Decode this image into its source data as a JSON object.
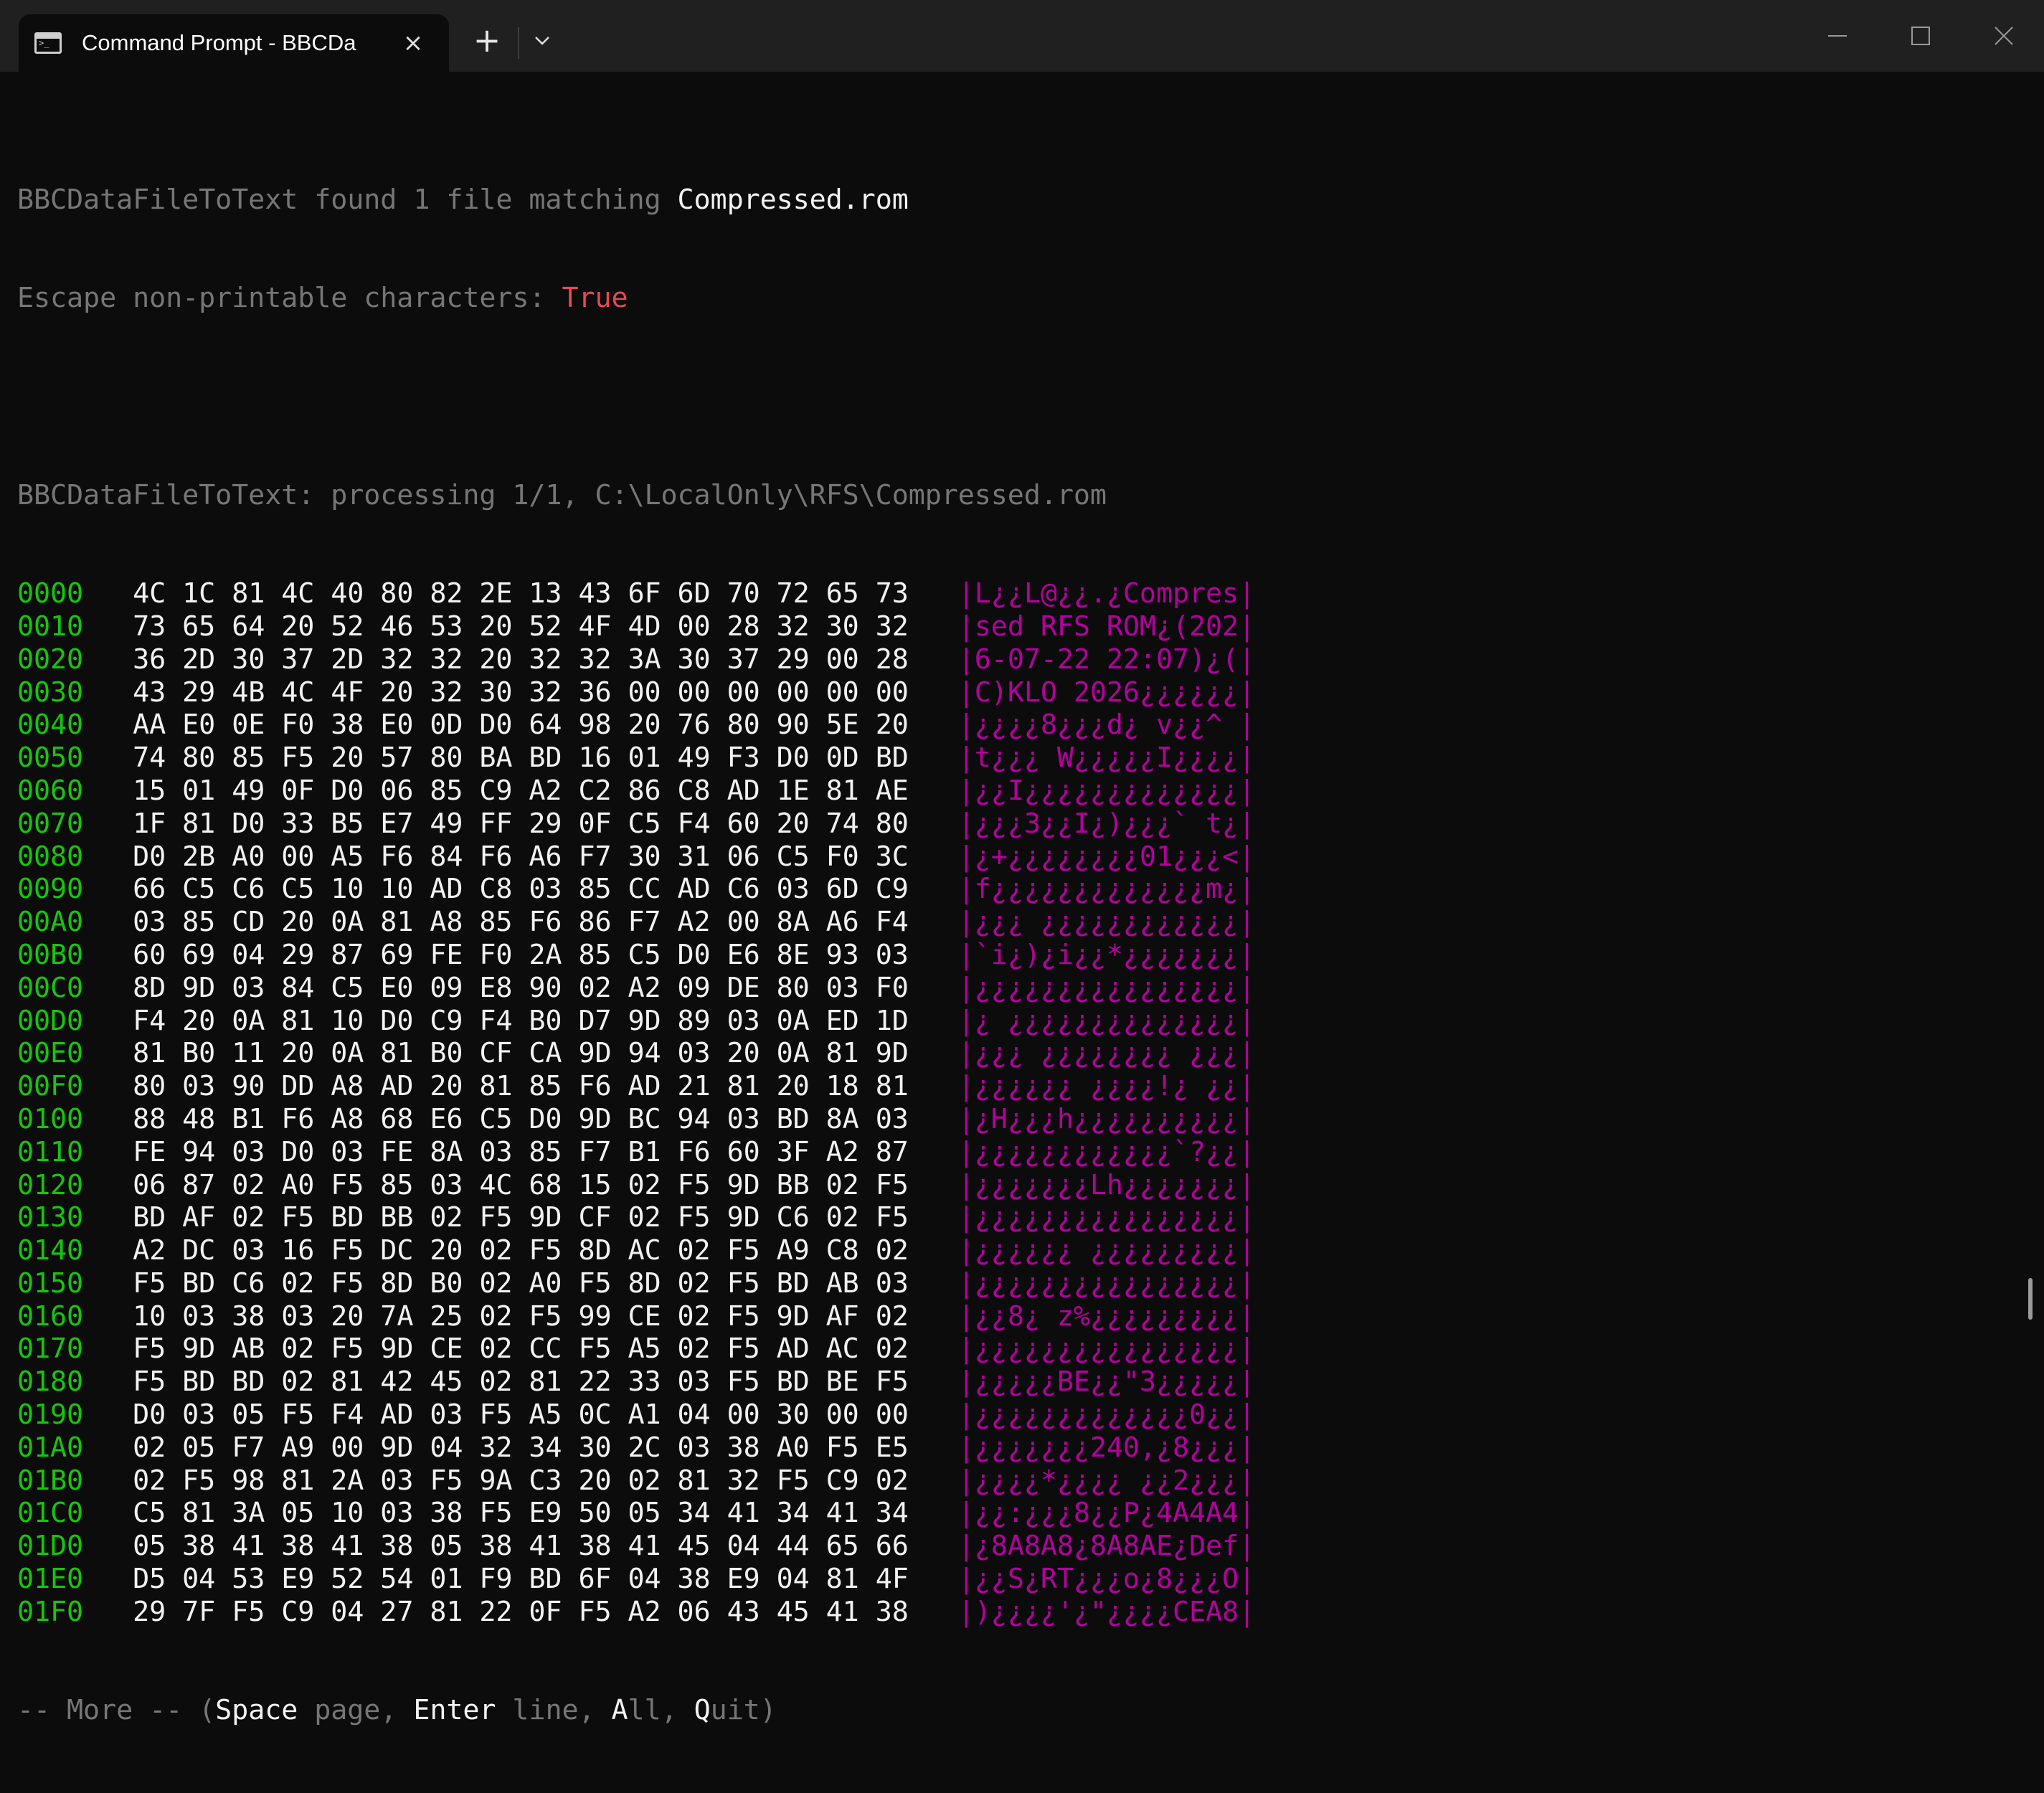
{
  "window": {
    "tab_title": "Command Prompt - BBCDa",
    "new_tab_label": "+",
    "close_tab_label": "×"
  },
  "terminal": {
    "line1": {
      "prefix": "BBCDataFileToText found 1 file matching ",
      "filename": "Compressed.rom"
    },
    "line2": {
      "prefix": "Escape non-printable characters: ",
      "value": "True"
    },
    "line4": "BBCDataFileToText: processing 1/1, C:\\LocalOnly\\RFS\\Compressed.rom",
    "dump": [
      {
        "addr": "0000",
        "hex": "4C 1C 81 4C 40 80 82 2E 13 43 6F 6D 70 72 65 73",
        "ascii": "|L¿¿L@¿¿.¿Compres|"
      },
      {
        "addr": "0010",
        "hex": "73 65 64 20 52 46 53 20 52 4F 4D 00 28 32 30 32",
        "ascii": "|sed RFS ROM¿(202|"
      },
      {
        "addr": "0020",
        "hex": "36 2D 30 37 2D 32 32 20 32 32 3A 30 37 29 00 28",
        "ascii": "|6-07-22 22:07)¿(|"
      },
      {
        "addr": "0030",
        "hex": "43 29 4B 4C 4F 20 32 30 32 36 00 00 00 00 00 00",
        "ascii": "|C)KLO 2026¿¿¿¿¿¿|"
      },
      {
        "addr": "0040",
        "hex": "AA E0 0E F0 38 E0 0D D0 64 98 20 76 80 90 5E 20",
        "ascii": "|¿¿¿¿8¿¿¿d¿ v¿¿^ |"
      },
      {
        "addr": "0050",
        "hex": "74 80 85 F5 20 57 80 BA BD 16 01 49 F3 D0 0D BD",
        "ascii": "|t¿¿¿ W¿¿¿¿¿I¿¿¿¿|"
      },
      {
        "addr": "0060",
        "hex": "15 01 49 0F D0 06 85 C9 A2 C2 86 C8 AD 1E 81 AE",
        "ascii": "|¿¿I¿¿¿¿¿¿¿¿¿¿¿¿¿|"
      },
      {
        "addr": "0070",
        "hex": "1F 81 D0 33 B5 E7 49 FF 29 0F C5 F4 60 20 74 80",
        "ascii": "|¿¿¿3¿¿I¿)¿¿¿` t¿|"
      },
      {
        "addr": "0080",
        "hex": "D0 2B A0 00 A5 F6 84 F6 A6 F7 30 31 06 C5 F0 3C",
        "ascii": "|¿+¿¿¿¿¿¿¿¿01¿¿¿<|"
      },
      {
        "addr": "0090",
        "hex": "66 C5 C6 C5 10 10 AD C8 03 85 CC AD C6 03 6D C9",
        "ascii": "|f¿¿¿¿¿¿¿¿¿¿¿¿¿m¿|"
      },
      {
        "addr": "00A0",
        "hex": "03 85 CD 20 0A 81 A8 85 F6 86 F7 A2 00 8A A6 F4",
        "ascii": "|¿¿¿ ¿¿¿¿¿¿¿¿¿¿¿¿|"
      },
      {
        "addr": "00B0",
        "hex": "60 69 04 29 87 69 FE F0 2A 85 C5 D0 E6 8E 93 03",
        "ascii": "|`i¿)¿i¿¿*¿¿¿¿¿¿¿|"
      },
      {
        "addr": "00C0",
        "hex": "8D 9D 03 84 C5 E0 09 E8 90 02 A2 09 DE 80 03 F0",
        "ascii": "|¿¿¿¿¿¿¿¿¿¿¿¿¿¿¿¿|"
      },
      {
        "addr": "00D0",
        "hex": "F4 20 0A 81 10 D0 C9 F4 B0 D7 9D 89 03 0A ED 1D",
        "ascii": "|¿ ¿¿¿¿¿¿¿¿¿¿¿¿¿¿|"
      },
      {
        "addr": "00E0",
        "hex": "81 B0 11 20 0A 81 B0 CF CA 9D 94 03 20 0A 81 9D",
        "ascii": "|¿¿¿ ¿¿¿¿¿¿¿¿ ¿¿¿|"
      },
      {
        "addr": "00F0",
        "hex": "80 03 90 DD A8 AD 20 81 85 F6 AD 21 81 20 18 81",
        "ascii": "|¿¿¿¿¿¿ ¿¿¿¿!¿ ¿¿|"
      },
      {
        "addr": "0100",
        "hex": "88 48 B1 F6 A8 68 E6 C5 D0 9D BC 94 03 BD 8A 03",
        "ascii": "|¿H¿¿¿h¿¿¿¿¿¿¿¿¿¿|"
      },
      {
        "addr": "0110",
        "hex": "FE 94 03 D0 03 FE 8A 03 85 F7 B1 F6 60 3F A2 87",
        "ascii": "|¿¿¿¿¿¿¿¿¿¿¿¿`?¿¿|"
      },
      {
        "addr": "0120",
        "hex": "06 87 02 A0 F5 85 03 4C 68 15 02 F5 9D BB 02 F5",
        "ascii": "|¿¿¿¿¿¿¿Lh¿¿¿¿¿¿¿|"
      },
      {
        "addr": "0130",
        "hex": "BD AF 02 F5 BD BB 02 F5 9D CF 02 F5 9D C6 02 F5",
        "ascii": "|¿¿¿¿¿¿¿¿¿¿¿¿¿¿¿¿|"
      },
      {
        "addr": "0140",
        "hex": "A2 DC 03 16 F5 DC 20 02 F5 8D AC 02 F5 A9 C8 02",
        "ascii": "|¿¿¿¿¿¿ ¿¿¿¿¿¿¿¿¿|"
      },
      {
        "addr": "0150",
        "hex": "F5 BD C6 02 F5 8D B0 02 A0 F5 8D 02 F5 BD AB 03",
        "ascii": "|¿¿¿¿¿¿¿¿¿¿¿¿¿¿¿¿|"
      },
      {
        "addr": "0160",
        "hex": "10 03 38 03 20 7A 25 02 F5 99 CE 02 F5 9D AF 02",
        "ascii": "|¿¿8¿ z%¿¿¿¿¿¿¿¿¿|"
      },
      {
        "addr": "0170",
        "hex": "F5 9D AB 02 F5 9D CE 02 CC F5 A5 02 F5 AD AC 02",
        "ascii": "|¿¿¿¿¿¿¿¿¿¿¿¿¿¿¿¿|"
      },
      {
        "addr": "0180",
        "hex": "F5 BD BD 02 81 42 45 02 81 22 33 03 F5 BD BE F5",
        "ascii": "|¿¿¿¿¿BE¿¿\"3¿¿¿¿¿|"
      },
      {
        "addr": "0190",
        "hex": "D0 03 05 F5 F4 AD 03 F5 A5 0C A1 04 00 30 00 00",
        "ascii": "|¿¿¿¿¿¿¿¿¿¿¿¿¿0¿¿|"
      },
      {
        "addr": "01A0",
        "hex": "02 05 F7 A9 00 9D 04 32 34 30 2C 03 38 A0 F5 E5",
        "ascii": "|¿¿¿¿¿¿¿240,¿8¿¿¿|"
      },
      {
        "addr": "01B0",
        "hex": "02 F5 98 81 2A 03 F5 9A C3 20 02 81 32 F5 C9 02",
        "ascii": "|¿¿¿¿*¿¿¿¿ ¿¿2¿¿¿|"
      },
      {
        "addr": "01C0",
        "hex": "C5 81 3A 05 10 03 38 F5 E9 50 05 34 41 34 41 34",
        "ascii": "|¿¿:¿¿¿8¿¿P¿4A4A4|"
      },
      {
        "addr": "01D0",
        "hex": "05 38 41 38 41 38 05 38 41 38 41 45 04 44 65 66",
        "ascii": "|¿8A8A8¿8A8AE¿Def|"
      },
      {
        "addr": "01E0",
        "hex": "D5 04 53 E9 52 54 01 F9 BD 6F 04 38 E9 04 81 4F",
        "ascii": "|¿¿S¿RT¿¿¿o¿8¿¿¿O|"
      },
      {
        "addr": "01F0",
        "hex": "29 7F F5 C9 04 27 81 22 0F F5 A2 06 43 45 41 38",
        "ascii": "|)¿¿¿¿'¿\"¿¿¿¿CEA8|"
      }
    ],
    "more_prompt": {
      "p1": "-- More -- (",
      "k1": "Space",
      "p2": " page, ",
      "k2": "Enter",
      "p3": " line, ",
      "k3": "A",
      "p4": "ll, ",
      "k4": "Q",
      "p5": "uit)"
    }
  },
  "colors": {
    "background": "#0c0c0c",
    "titlebar": "#202020",
    "address": "#16c60c",
    "ascii": "#b4009e",
    "muted": "#767676",
    "true_value": "#e74856"
  }
}
